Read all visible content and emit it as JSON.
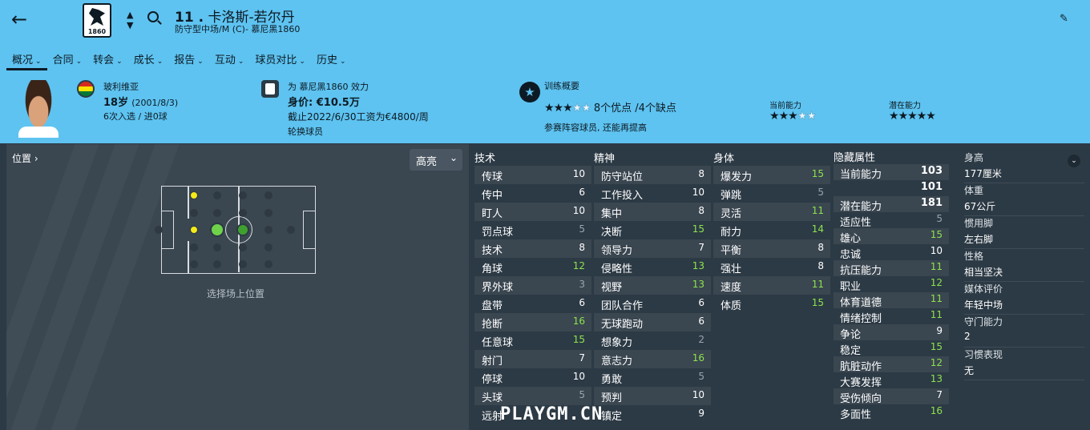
{
  "header": {
    "back_icon": "←",
    "club_year": "1860",
    "updown": "⌃⌄",
    "number": "11 .",
    "player_name": "卡洛斯-若尔丹",
    "subtitle": "防守型中场/M (C)- 慕尼黑1860",
    "edit_icon": "✎"
  },
  "tabs": [
    {
      "label": "概况"
    },
    {
      "label": "合同"
    },
    {
      "label": "转会"
    },
    {
      "label": "成长"
    },
    {
      "label": "报告"
    },
    {
      "label": "互动"
    },
    {
      "label": "球员对比"
    },
    {
      "label": "历史"
    }
  ],
  "profile": {
    "nationality": "玻利维亚",
    "age": "18岁",
    "birth": "(2001/8/3)",
    "caps": "6次入选 / 进0球",
    "club_line": "为 慕尼黑1860 效力",
    "value_label": "身价: ",
    "value": "€10.5万",
    "contract": "截止2022/6/30工资为€4800/周",
    "role": "轮换球员"
  },
  "training": {
    "title": "训练概要",
    "stars_full": 3,
    "stars_half": 0,
    "stars_total": 5,
    "summary": "8个优点 /4个缺点",
    "note": "参赛阵容球员, 还能再提高",
    "ca_label": "当前能力",
    "ca_stars": 3,
    "pa_label": "潜在能力",
    "pa_stars": 5
  },
  "position_panel": {
    "title": "位置 ›",
    "dropdown": "高亮",
    "caption": "选择场上位置"
  },
  "attributes": {
    "technical": {
      "title": "技术",
      "items": [
        {
          "n": "传球",
          "v": "10",
          "c": "w"
        },
        {
          "n": "传中",
          "v": "6",
          "c": "w"
        },
        {
          "n": "盯人",
          "v": "10",
          "c": "w"
        },
        {
          "n": "罚点球",
          "v": "5",
          "c": "gr"
        },
        {
          "n": "技术",
          "v": "8",
          "c": "w"
        },
        {
          "n": "角球",
          "v": "12",
          "c": "g"
        },
        {
          "n": "界外球",
          "v": "3",
          "c": "gr"
        },
        {
          "n": "盘带",
          "v": "6",
          "c": "w"
        },
        {
          "n": "抢断",
          "v": "16",
          "c": "g"
        },
        {
          "n": "任意球",
          "v": "15",
          "c": "g"
        },
        {
          "n": "射门",
          "v": "7",
          "c": "w"
        },
        {
          "n": "停球",
          "v": "10",
          "c": "w"
        },
        {
          "n": "头球",
          "v": "5",
          "c": "gr"
        },
        {
          "n": "远射",
          "v": "",
          "c": "w"
        }
      ]
    },
    "mental": {
      "title": "精神",
      "items": [
        {
          "n": "防守站位",
          "v": "8",
          "c": "w"
        },
        {
          "n": "工作投入",
          "v": "10",
          "c": "w"
        },
        {
          "n": "集中",
          "v": "8",
          "c": "w"
        },
        {
          "n": "决断",
          "v": "15",
          "c": "g"
        },
        {
          "n": "领导力",
          "v": "7",
          "c": "w"
        },
        {
          "n": "侵略性",
          "v": "13",
          "c": "g"
        },
        {
          "n": "视野",
          "v": "13",
          "c": "g"
        },
        {
          "n": "团队合作",
          "v": "6",
          "c": "w"
        },
        {
          "n": "无球跑动",
          "v": "6",
          "c": "w"
        },
        {
          "n": "想象力",
          "v": "2",
          "c": "gr"
        },
        {
          "n": "意志力",
          "v": "16",
          "c": "g"
        },
        {
          "n": "勇敢",
          "v": "5",
          "c": "gr"
        },
        {
          "n": "预判",
          "v": "10",
          "c": "w"
        },
        {
          "n": "镇定",
          "v": "9",
          "c": "w"
        }
      ]
    },
    "physical": {
      "title": "身体",
      "items": [
        {
          "n": "爆发力",
          "v": "15",
          "c": "g"
        },
        {
          "n": "弹跳",
          "v": "5",
          "c": "gr"
        },
        {
          "n": "灵活",
          "v": "11",
          "c": "g"
        },
        {
          "n": "耐力",
          "v": "14",
          "c": "g"
        },
        {
          "n": "平衡",
          "v": "8",
          "c": "w"
        },
        {
          "n": "强壮",
          "v": "8",
          "c": "w"
        },
        {
          "n": "速度",
          "v": "11",
          "c": "g"
        },
        {
          "n": "体质",
          "v": "15",
          "c": "g"
        }
      ]
    }
  },
  "hidden": {
    "title": "隐藏属性",
    "items": [
      {
        "n": "当前能力",
        "v": "103",
        "c": "w",
        "big": true
      },
      {
        "n": "",
        "v": "101",
        "c": "w",
        "big": true
      },
      {
        "n": "潜在能力",
        "v": "181",
        "c": "w",
        "big": true
      },
      {
        "n": "适应性",
        "v": "5",
        "c": "gr"
      },
      {
        "n": "雄心",
        "v": "15",
        "c": "g"
      },
      {
        "n": "忠诚",
        "v": "10",
        "c": "w"
      },
      {
        "n": "抗压能力",
        "v": "11",
        "c": "g"
      },
      {
        "n": "职业",
        "v": "12",
        "c": "g"
      },
      {
        "n": "体育道德",
        "v": "11",
        "c": "g"
      },
      {
        "n": "情绪控制",
        "v": "11",
        "c": "g"
      },
      {
        "n": "争论",
        "v": "9",
        "c": "w"
      },
      {
        "n": "稳定",
        "v": "15",
        "c": "g"
      },
      {
        "n": "肮脏动作",
        "v": "12",
        "c": "g"
      },
      {
        "n": "大赛发挥",
        "v": "13",
        "c": "g"
      },
      {
        "n": "受伤倾向",
        "v": "7",
        "c": "w"
      },
      {
        "n": "多面性",
        "v": "16",
        "c": "g"
      }
    ]
  },
  "info": [
    {
      "l": "身高",
      "d": "177厘米"
    },
    {
      "l": "体重",
      "d": "67公斤"
    },
    {
      "l": "惯用脚",
      "d": "左右脚"
    },
    {
      "l": "性格",
      "d": "相当坚决"
    },
    {
      "l": "媒体评价",
      "d": "年轻中场"
    },
    {
      "l": "守门能力",
      "d": "2"
    },
    {
      "l": "习惯表现",
      "d": "无"
    }
  ],
  "watermark": "PLAYGM.CN",
  "colors": {
    "header_bg": "#5ec3f0",
    "body_bg": "#2c3a45",
    "good": "#8de34d",
    "poor": "#9aa5ae"
  }
}
